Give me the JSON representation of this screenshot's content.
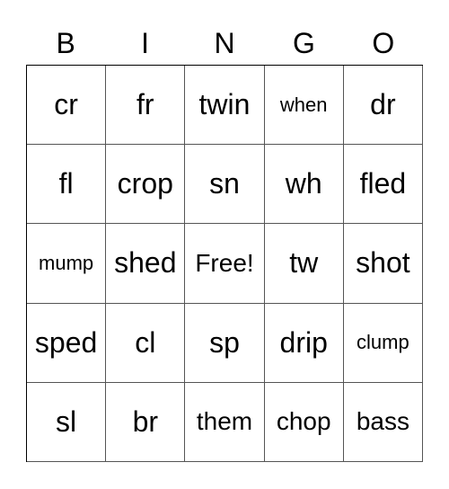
{
  "card": {
    "header": [
      "B",
      "I",
      "N",
      "G",
      "O"
    ],
    "rows": [
      [
        "cr",
        "fr",
        "twin",
        "when",
        "dr"
      ],
      [
        "fl",
        "crop",
        "sn",
        "wh",
        "fled"
      ],
      [
        "mump",
        "shed",
        "Free!",
        "tw",
        "shot"
      ],
      [
        "sped",
        "cl",
        "sp",
        "drip",
        "clump"
      ],
      [
        "sl",
        "br",
        "them",
        "chop",
        "bass"
      ]
    ]
  }
}
